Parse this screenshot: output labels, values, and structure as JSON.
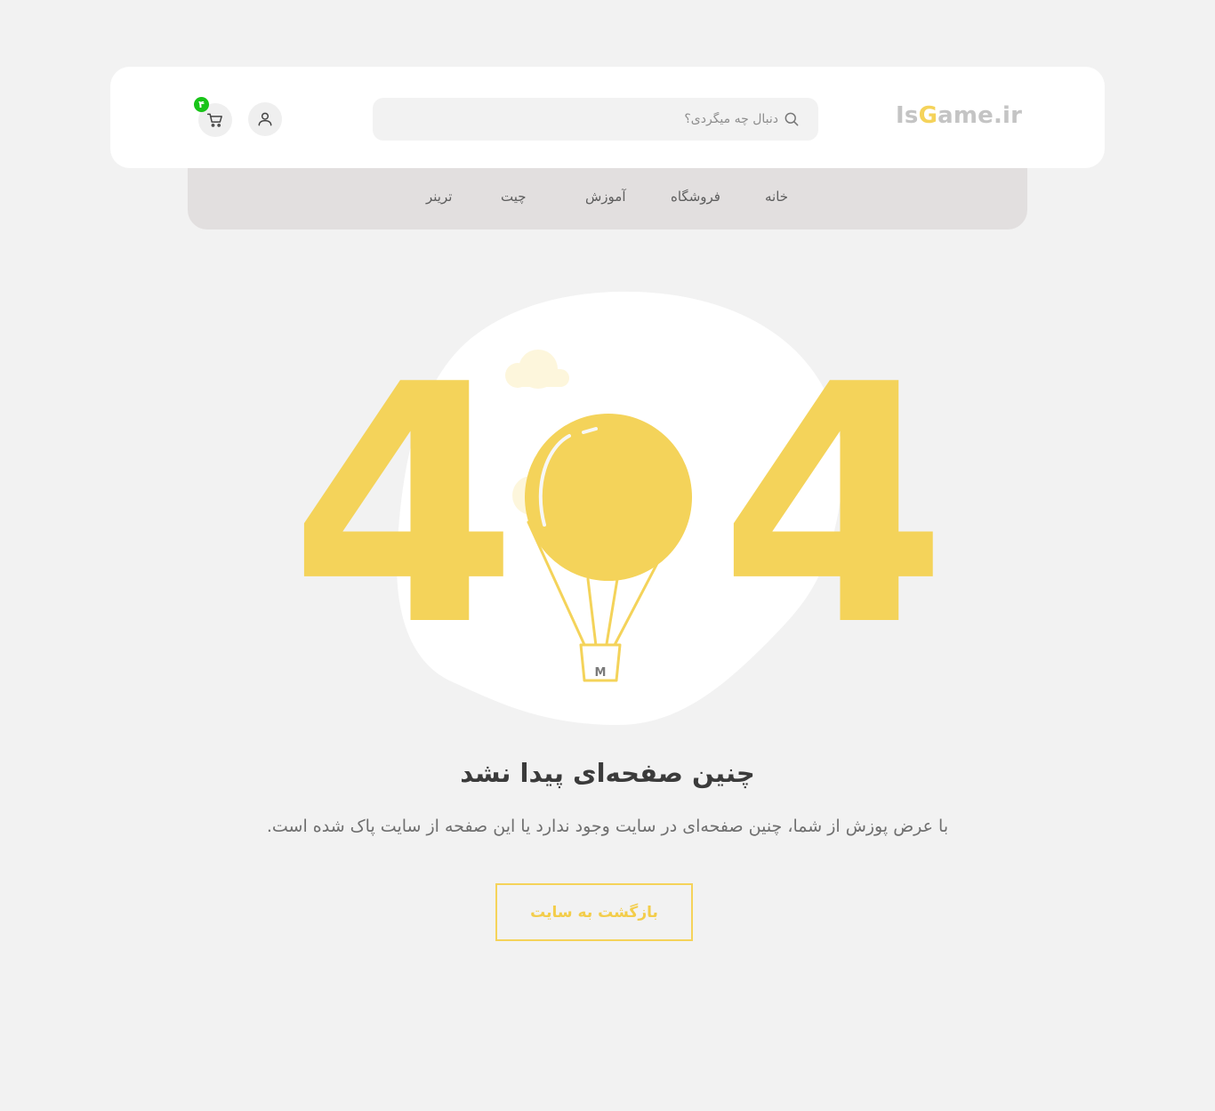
{
  "header": {
    "logo": {
      "part1": "Is",
      "part2": "G",
      "part3": "ame.ir"
    },
    "search": {
      "placeholder": "دنبال چه میگردی؟"
    },
    "cart": {
      "count": "۴"
    }
  },
  "nav": {
    "items": [
      {
        "label": "خانه"
      },
      {
        "label": "فروشگاه"
      },
      {
        "label": "آموزش"
      },
      {
        "label": "چیت"
      },
      {
        "label": "ترینر"
      }
    ]
  },
  "error": {
    "digit_left": "4",
    "digit_right": "4",
    "basket_mark": "M",
    "title": "چنین صفحه‌ای پیدا نشد",
    "message": "با عرض پوزش از شما، چنین صفحه‌ای در سایت وجود ندارد یا این صفحه از سایت پاک شده است.",
    "button_label": "بازگشت به سایت"
  },
  "colors": {
    "accent": "#f5d35a",
    "background": "#f2f2f2",
    "nav_background": "#e2dfdf",
    "badge": "#18c418"
  },
  "icons": [
    "search-icon",
    "user-icon",
    "cart-icon",
    "cloud-icon",
    "balloon-icon"
  ]
}
